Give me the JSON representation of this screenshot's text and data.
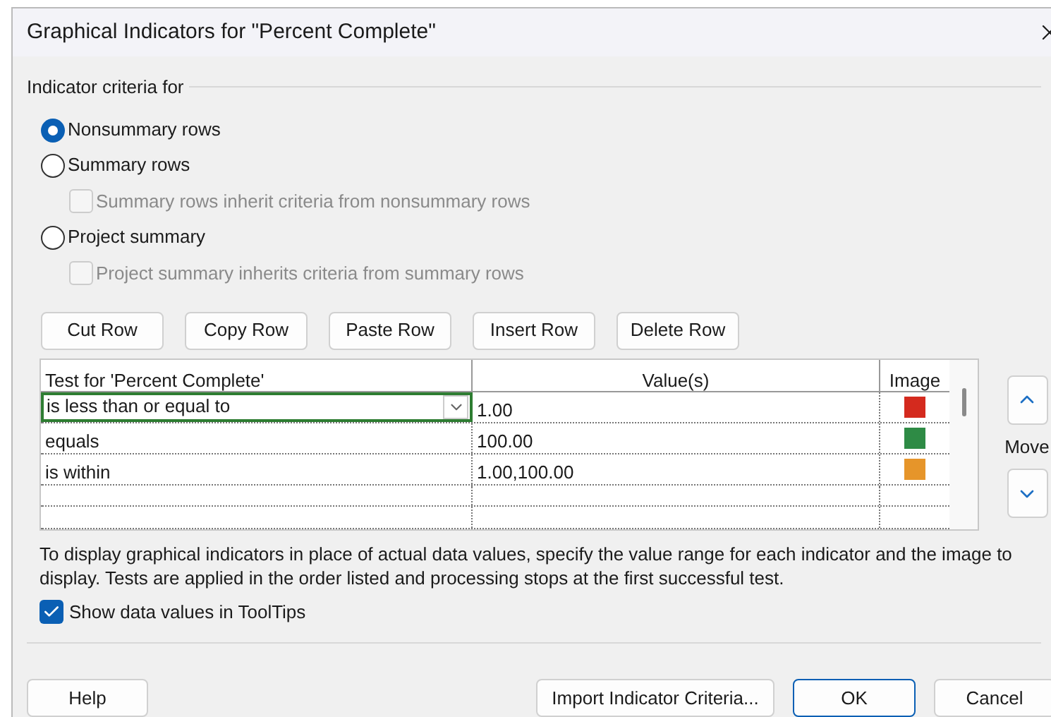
{
  "window": {
    "title": "Graphical Indicators for \"Percent Complete\""
  },
  "criteria": {
    "legend": "Indicator criteria for",
    "options": [
      {
        "label": "Nonsummary rows",
        "selected": true
      },
      {
        "label": "Summary rows",
        "selected": false,
        "children": [
          {
            "label": "Summary rows inherit criteria from nonsummary rows",
            "checked": false,
            "disabled": true
          }
        ]
      },
      {
        "label": "Project summary",
        "selected": false,
        "children": [
          {
            "label": "Project summary inherits criteria from summary rows",
            "checked": false,
            "disabled": true
          }
        ]
      }
    ]
  },
  "row_buttons": [
    "Cut Row",
    "Copy Row",
    "Paste Row",
    "Insert Row",
    "Delete Row"
  ],
  "table": {
    "columns": [
      "Test for 'Percent Complete'",
      "Value(s)",
      "Image"
    ],
    "rows": [
      {
        "test": "is less than or equal to",
        "value": "1.00",
        "color": "#d42a1e",
        "selected": true
      },
      {
        "test": "equals",
        "value": "100.00",
        "color": "#2e8b45",
        "selected": false
      },
      {
        "test": "is within",
        "value": "1.00,100.00",
        "color": "#e6952a",
        "selected": false
      }
    ]
  },
  "move_label": "Move",
  "description": "To display graphical indicators in place of actual data values, specify the value range for each indicator and the image to display.  Tests are applied in the order listed and processing stops at the first successful test.",
  "tooltips_option": {
    "label": "Show data values in ToolTips",
    "checked": true
  },
  "buttons": [
    {
      "label": "Help",
      "kind": "left"
    },
    {
      "label": "Import Indicator Criteria...",
      "kind": "right"
    },
    {
      "label": "OK",
      "kind": "default"
    },
    {
      "label": "Cancel",
      "kind": "right"
    }
  ]
}
